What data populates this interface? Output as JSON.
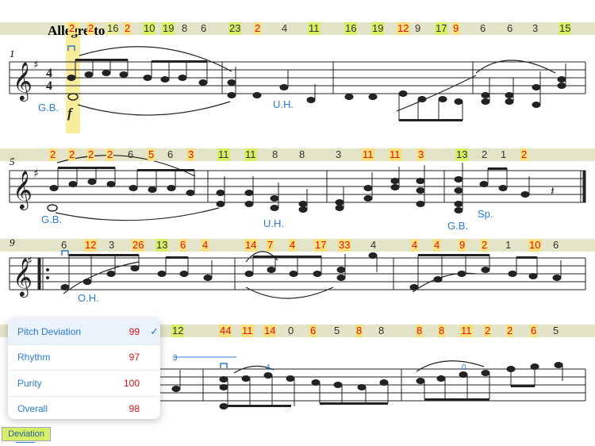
{
  "score": {
    "tempo": "Allegretto",
    "measure_numbers": [
      "1",
      "5",
      "9"
    ],
    "rows": [
      {
        "deviations": [
          {
            "v": "2",
            "hl": "hi",
            "red": true
          },
          {
            "v": "2",
            "hl": "hi",
            "red": true
          },
          {
            "v": "16",
            "hl": "mid"
          },
          {
            "v": "2",
            "hl": "hi",
            "red": true
          },
          {
            "v": "10",
            "hl": "low"
          },
          {
            "v": "19",
            "hl": "low"
          },
          {
            "v": "8",
            "hl": "none"
          },
          {
            "v": "6",
            "hl": "none"
          },
          {
            "v": "23",
            "hl": "low"
          },
          {
            "v": "2",
            "hl": "hi",
            "red": true
          },
          {
            "v": "4",
            "hl": "none"
          },
          {
            "v": "11",
            "hl": "low"
          },
          {
            "v": "16",
            "hl": "low"
          },
          {
            "v": "19",
            "hl": "low"
          },
          {
            "v": "12",
            "hl": "hi",
            "red": true
          },
          {
            "v": "9",
            "hl": "none"
          },
          {
            "v": "17",
            "hl": "low"
          },
          {
            "v": "9",
            "hl": "hi",
            "red": true
          },
          {
            "v": "6",
            "hl": "none"
          },
          {
            "v": "6",
            "hl": "none"
          },
          {
            "v": "3",
            "hl": "none"
          },
          {
            "v": "15",
            "hl": "low"
          }
        ]
      },
      {
        "deviations": [
          {
            "v": "2",
            "hl": "hi",
            "red": true
          },
          {
            "v": "2",
            "hl": "hi",
            "red": true
          },
          {
            "v": "2",
            "hl": "hi",
            "red": true
          },
          {
            "v": "2",
            "hl": "hi",
            "red": true
          },
          {
            "v": "6",
            "hl": "none"
          },
          {
            "v": "5",
            "hl": "hi",
            "red": true
          },
          {
            "v": "6",
            "hl": "none"
          },
          {
            "v": "3",
            "hl": "hi",
            "red": true
          },
          {
            "v": "11",
            "hl": "low"
          },
          {
            "v": "11",
            "hl": "low"
          },
          {
            "v": "8",
            "hl": "none"
          },
          {
            "v": "8",
            "hl": "none"
          },
          {
            "v": "3",
            "hl": "none"
          },
          {
            "v": "11",
            "hl": "hi",
            "red": true
          },
          {
            "v": "11",
            "hl": "hi",
            "red": true
          },
          {
            "v": "3",
            "hl": "hi",
            "red": true
          },
          {
            "v": "13",
            "hl": "low"
          },
          {
            "v": "2",
            "hl": "none"
          },
          {
            "v": "1",
            "hl": "none"
          },
          {
            "v": "2",
            "hl": "hi",
            "red": true
          }
        ]
      },
      {
        "deviations": [
          {
            "v": "6",
            "hl": "none"
          },
          {
            "v": "12",
            "hl": "hi",
            "red": true
          },
          {
            "v": "3",
            "hl": "none"
          },
          {
            "v": "26",
            "hl": "hi",
            "red": true
          },
          {
            "v": "13",
            "hl": "low"
          },
          {
            "v": "6",
            "hl": "hi",
            "red": true
          },
          {
            "v": "4",
            "hl": "hi",
            "red": true
          },
          {
            "v": "14",
            "hl": "hi",
            "red": true
          },
          {
            "v": "7",
            "hl": "hi",
            "red": true
          },
          {
            "v": "4",
            "hl": "hi",
            "red": true
          },
          {
            "v": "17",
            "hl": "hi",
            "red": true
          },
          {
            "v": "33",
            "hl": "hi",
            "red": true
          },
          {
            "v": "4",
            "hl": "none"
          },
          {
            "v": "4",
            "hl": "hi",
            "red": true
          },
          {
            "v": "4",
            "hl": "hi",
            "red": true
          },
          {
            "v": "9",
            "hl": "hi",
            "red": true
          },
          {
            "v": "2",
            "hl": "hi",
            "red": true
          },
          {
            "v": "1",
            "hl": "none"
          },
          {
            "v": "10",
            "hl": "hi",
            "red": true
          },
          {
            "v": "6",
            "hl": "none"
          }
        ]
      },
      {
        "deviations": [
          {
            "v": "12",
            "hl": "low"
          },
          {
            "v": "44",
            "hl": "hi",
            "red": true
          },
          {
            "v": "11",
            "hl": "hi",
            "red": true
          },
          {
            "v": "14",
            "hl": "hi",
            "red": true
          },
          {
            "v": "0",
            "hl": "none"
          },
          {
            "v": "6",
            "hl": "hi",
            "red": true
          },
          {
            "v": "5",
            "hl": "none"
          },
          {
            "v": "8",
            "hl": "hi",
            "red": true
          },
          {
            "v": "8",
            "hl": "none"
          },
          {
            "v": "8",
            "hl": "hi",
            "red": true
          },
          {
            "v": "8",
            "hl": "hi",
            "red": true
          },
          {
            "v": "11",
            "hl": "hi",
            "red": true
          },
          {
            "v": "2",
            "hl": "hi",
            "red": true
          },
          {
            "v": "2",
            "hl": "hi",
            "red": true
          },
          {
            "v": "6",
            "hl": "hi",
            "red": true
          },
          {
            "v": "5",
            "hl": "none"
          }
        ]
      }
    ],
    "annotations": {
      "gb1": "G.B.",
      "uh1": "U.H.",
      "gb2": "G.B.",
      "uh2": "U.H.",
      "gb3": "G.B.",
      "sp": "Sp.",
      "oh": "O.H."
    },
    "fingerings": [
      "4",
      "0",
      "3"
    ]
  },
  "metrics_panel": {
    "items": [
      {
        "label": "Pitch Deviation",
        "value": "99",
        "selected": true
      },
      {
        "label": "Rhythm",
        "value": "97",
        "selected": false
      },
      {
        "label": "Purity",
        "value": "100",
        "selected": false
      },
      {
        "label": "Overall",
        "value": "98",
        "selected": false
      }
    ],
    "checkmark": "✓"
  },
  "mode_button": {
    "label": "Deviation"
  }
}
